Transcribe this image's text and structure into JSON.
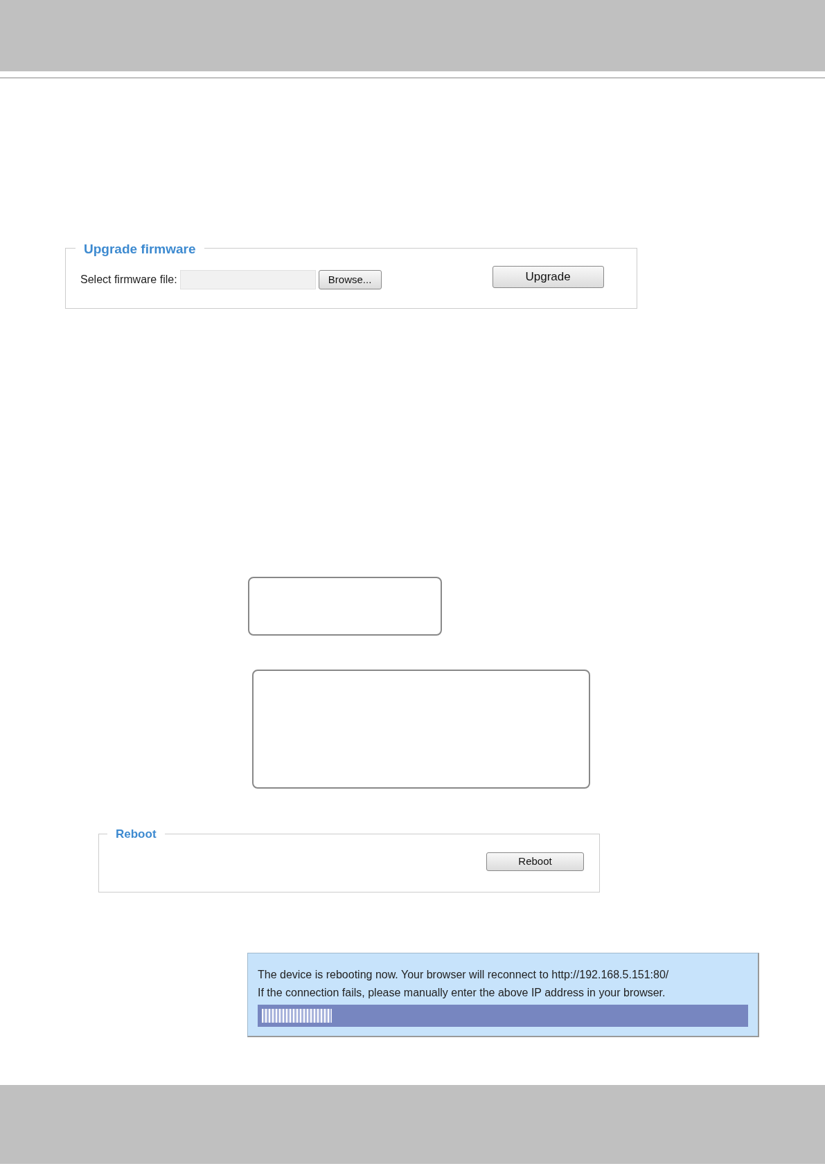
{
  "upgrade_panel": {
    "title": "Upgrade firmware",
    "file_label": "Select firmware file:",
    "browse_button": "Browse...",
    "upgrade_button": "Upgrade"
  },
  "reboot_panel": {
    "title": "Reboot",
    "reboot_button": "Reboot"
  },
  "reboot_message": {
    "lines": [
      "The device is rebooting now. Your browser will reconnect to http://192.168.5.151:80/",
      "If the connection fails, please manually enter the above IP address in your browser."
    ],
    "progress": {
      "level": 0.16
    }
  }
}
